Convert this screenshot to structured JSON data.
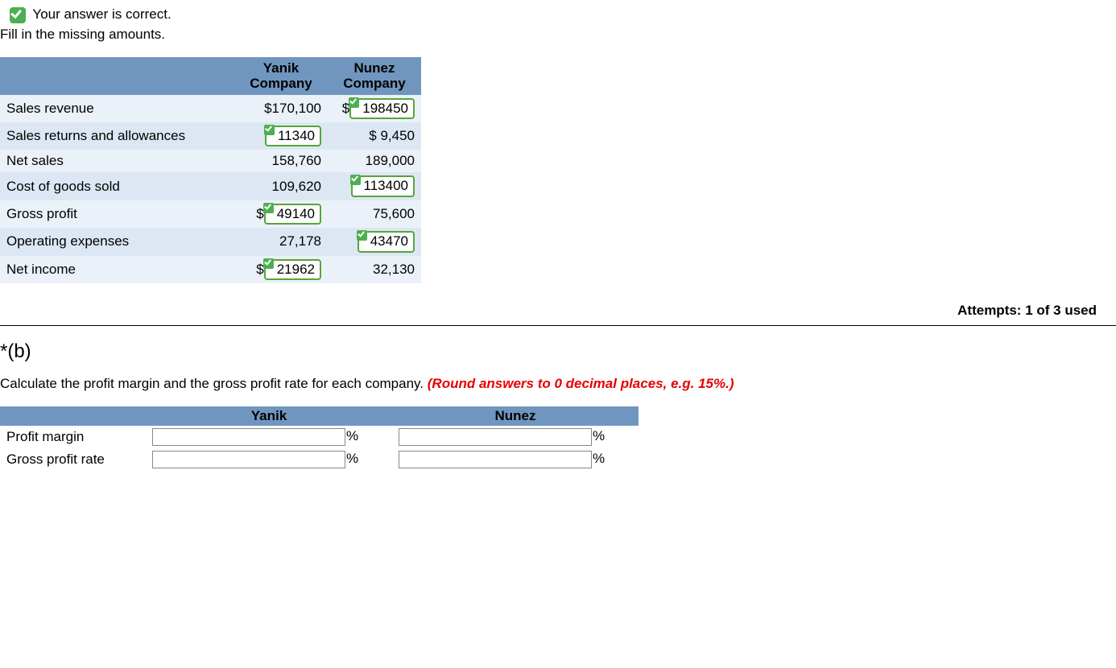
{
  "feedback": {
    "correct_text": "Your answer is correct."
  },
  "instruction_a": "Fill in the missing amounts.",
  "columns": {
    "yanik": "Yanik Company",
    "nunez": "Nunez Company"
  },
  "rows": {
    "sales_revenue": {
      "label": "Sales revenue",
      "yanik": {
        "text": "$170,100",
        "is_answer": false
      },
      "nunez": {
        "text": "198450",
        "prefix": "$",
        "is_answer": true
      }
    },
    "sales_returns": {
      "label": "Sales returns and allowances",
      "yanik": {
        "text": "11340",
        "is_answer": true
      },
      "nunez": {
        "text": "$ 9,450",
        "is_answer": false
      }
    },
    "net_sales": {
      "label": "Net sales",
      "yanik": {
        "text": "158,760",
        "is_answer": false
      },
      "nunez": {
        "text": "189,000",
        "is_answer": false
      }
    },
    "cogs": {
      "label": "Cost of goods sold",
      "yanik": {
        "text": "109,620",
        "is_answer": false
      },
      "nunez": {
        "text": "113400",
        "is_answer": true
      }
    },
    "gross_profit": {
      "label": "Gross profit",
      "yanik": {
        "text": "49140",
        "prefix": "$",
        "is_answer": true
      },
      "nunez": {
        "text": "75,600",
        "is_answer": false
      }
    },
    "op_exp": {
      "label": "Operating expenses",
      "yanik": {
        "text": "27,178",
        "is_answer": false
      },
      "nunez": {
        "text": "43470",
        "is_answer": true
      }
    },
    "net_income": {
      "label": "Net income",
      "yanik": {
        "text": "21962",
        "prefix": "$",
        "is_answer": true
      },
      "nunez": {
        "text": "32,130",
        "is_answer": false
      }
    }
  },
  "attempts": "Attempts: 1 of 3 used",
  "part_b": {
    "heading": "*(b)",
    "instruction_prefix": "Calculate the profit margin and the gross profit rate for each company. ",
    "round_note": "(Round answers to 0 decimal places, e.g. 15%.)",
    "col_yanik": "Yanik",
    "col_nunez": "Nunez",
    "row_profit_margin": "Profit margin",
    "row_gross_profit_rate": "Gross profit rate",
    "pct_sign": "%"
  }
}
